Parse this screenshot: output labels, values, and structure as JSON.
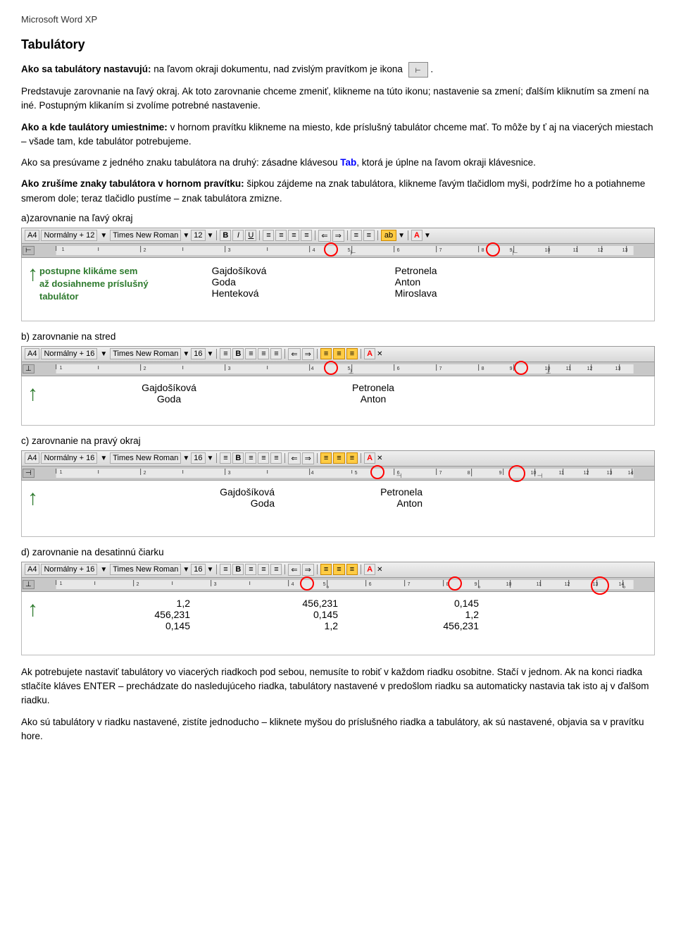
{
  "page": {
    "title": "Microsoft Word XP",
    "heading": "Tabulátory",
    "intro_1_bold": "Ako sa  tabulátory nastavujú:",
    "intro_1_rest": " na ľavom okraji dokumentu, nad zvislým pravítkom je ikona",
    "intro_2": "Predstavuje zarovnanie na ľavý okraj. Ak toto zarovnanie chceme zmeniť, klikneme na túto ikonu; nastavenie sa zmení; ďalším kliknutím sa zmení na iné. Postupným klikaním si zvolíme potrebné nastavenie.",
    "intro_3_bold": "Ako a kde taulátory umiestnime:",
    "intro_3_rest": " v hornom pravítku klikneme na miesto, kde príslušný tabulátor chceme mať. To môže by ť aj na viacerých miestach – všade tam, kde tabulátor potrebujeme.",
    "intro_4": "Ako sa presúvame z jedného znaku tabulátora na druhý: zásadne klávesou Tab, ktorá je úplne na ľavom okraji klávesnice.",
    "intro_4_tab": "Tab",
    "intro_5_bold": "Ako zrušíme znaky tabulátora v hornom pravítku:",
    "intro_5_rest": " šipkou zájdeme na znak tabulátora, klikneme ľavým tlačidlom myši, podržíme ho a potiahneme smerom dole; teraz tlačidlo pustíme – znak tabulátora zmizne.",
    "section_a_label": "a)zarovnanie na ľavý okraj",
    "section_b_label": "b) zarovnanie na stred",
    "section_c_label": "c) zarovnanie na pravý okraj",
    "section_d_label": "d) zarovnanie na desatinnú čiarku",
    "green_text_a": "postupne klikáme sem\naž dosiahneme príslušný\ntabulátor",
    "col_a_names": [
      "Gajdošíková",
      "Goda",
      "Henteková"
    ],
    "col_a_right": [
      "Petronela",
      "Anton",
      "Miroslava"
    ],
    "col_b_left": [
      "Gajdošíková",
      "Goda"
    ],
    "col_b_right": [
      "Petronela",
      "Anton"
    ],
    "col_c_left": [
      "Gajdošíková",
      "Goda"
    ],
    "col_c_right": [
      "Petronela",
      "Anton"
    ],
    "col_d_left": [
      "1,2",
      "456,231",
      "0,145"
    ],
    "col_d_mid": [
      "456,231",
      "0,145",
      "1,2"
    ],
    "col_d_right": [
      "0,145",
      "1,2",
      "456,231"
    ],
    "toolbar_style": "Normálny + 12",
    "toolbar_font": "Times New Roman",
    "toolbar_size": "12",
    "toolbar_style2": "Normálny + 16",
    "toolbar_font2": "Times New Roman",
    "toolbar_size2": "16",
    "footer_text": "Ak potrebujete nastaviť tabulátory vo viacerých riadkoch pod sebou, nemusíte to robiť v každom riadku osobitne. Stačí v jednom. Ak na konci riadka stlačíte kláves ENTER – prechádzate do nasledujúceho riadka, tabulátory nastavené v predošlom riadku sa automaticky nastavia tak isto aj v ďalšom riadku.",
    "footer_text2": "Ako sú tabulátory v riadku nastavené, zistíte jednoducho – kliknete myšou do príslušného riadka a tabulátory, ak sú nastavené, objavia sa v pravítku hore."
  }
}
